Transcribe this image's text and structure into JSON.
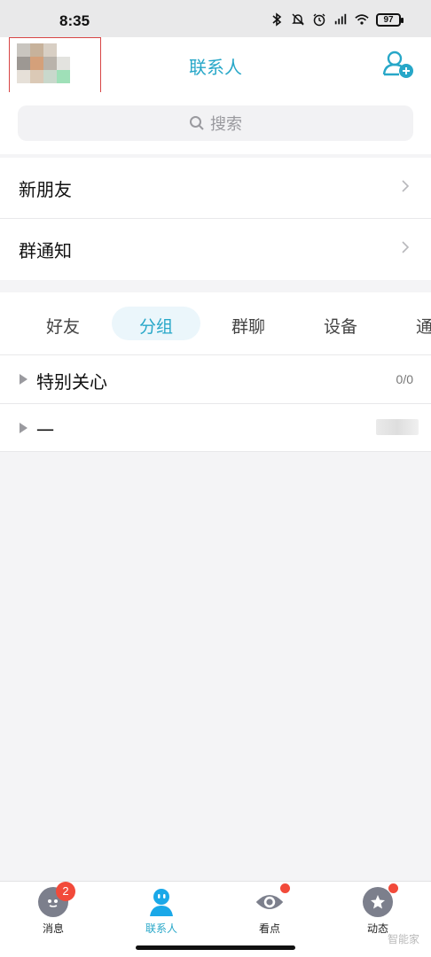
{
  "status_bar": {
    "time": "8:35",
    "battery": "97",
    "icons": [
      "bluetooth-icon",
      "mute-icon",
      "alarm-icon",
      "hd-signal-icon",
      "wifi-icon",
      "battery-icon"
    ]
  },
  "header": {
    "title": "联系人",
    "avatar": "avatar-blurred",
    "add_icon": "add-friend-icon"
  },
  "search": {
    "placeholder": "搜索"
  },
  "rows": [
    {
      "label": "新朋友"
    },
    {
      "label": "群通知"
    }
  ],
  "tabs": [
    {
      "label": "好友",
      "active": false
    },
    {
      "label": "分组",
      "active": true
    },
    {
      "label": "群聊",
      "active": false
    },
    {
      "label": "设备",
      "active": false
    },
    {
      "label": "通",
      "active": false
    }
  ],
  "groups": [
    {
      "name": "特别关心",
      "count": "0/0"
    },
    {
      "name": "一",
      "count": ""
    }
  ],
  "bottom_nav": [
    {
      "label": "消息",
      "badge": "2",
      "icon": "message-icon",
      "active": false
    },
    {
      "label": "联系人",
      "badge": "",
      "icon": "contacts-icon",
      "active": true
    },
    {
      "label": "看点",
      "badge": "",
      "icon": "eye-icon",
      "active": false
    },
    {
      "label": "动态",
      "badge": "",
      "icon": "star-icon",
      "active": false
    }
  ],
  "colors": {
    "accent": "#27a7c8",
    "badge": "#f24a3a"
  },
  "watermark": "智能家"
}
